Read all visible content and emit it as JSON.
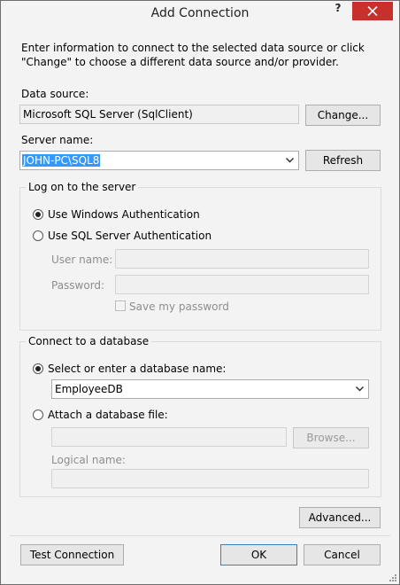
{
  "window": {
    "title": "Add Connection",
    "help_glyph": "?",
    "close_icon": "close-icon"
  },
  "intro": "Enter information to connect to the selected data source or click \"Change\" to choose a different data source and/or provider.",
  "data_source": {
    "label": "Data source:",
    "value": "Microsoft SQL Server (SqlClient)",
    "change_button": "Change..."
  },
  "server": {
    "label": "Server name:",
    "value": "JOHN-PC\\SQL8",
    "refresh_button": "Refresh"
  },
  "logon": {
    "group_title": "Log on to the server",
    "windows_auth": "Use Windows Authentication",
    "sql_auth": "Use SQL Server Authentication",
    "selected": "windows_auth",
    "user_name_label": "User name:",
    "user_name_value": "",
    "password_label": "Password:",
    "password_value": "",
    "save_password": "Save my password",
    "save_password_checked": false
  },
  "database": {
    "group_title": "Connect to a database",
    "select_option": "Select or enter a database name:",
    "database_value": "EmployeeDB",
    "attach_option": "Attach a database file:",
    "attach_value": "",
    "browse_button": "Browse...",
    "logical_name_label": "Logical name:",
    "logical_name_value": "",
    "selected": "select_option"
  },
  "advanced_button": "Advanced...",
  "footer": {
    "test_button": "Test Connection",
    "ok_button": "OK",
    "cancel_button": "Cancel"
  },
  "colors": {
    "close_button": "#c7302b",
    "selection": "#3399ff",
    "default_button_border": "#3c7fb1"
  }
}
